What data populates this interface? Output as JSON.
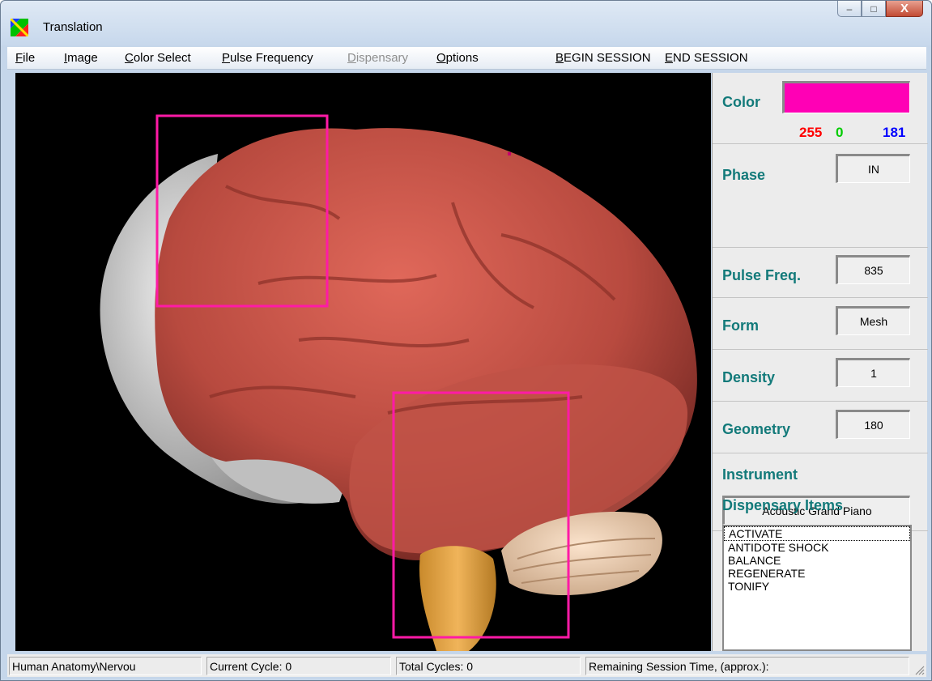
{
  "window": {
    "title": "Translation",
    "controls": {
      "minimize": "–",
      "maximize": "□",
      "close": "X"
    }
  },
  "menu": [
    {
      "pre": "",
      "ul": "F",
      "post": "ile"
    },
    {
      "pre": "",
      "ul": "I",
      "post": "mage"
    },
    {
      "pre": "",
      "ul": "C",
      "post": "olor Select"
    },
    {
      "pre": "",
      "ul": "P",
      "post": "ulse Frequency"
    },
    {
      "pre": "",
      "ul": "D",
      "post": "ispensary"
    },
    {
      "pre": "",
      "ul": "O",
      "post": "ptions"
    },
    {
      "pre": "",
      "ul": "B",
      "post": "EGIN SESSION"
    },
    {
      "pre": "",
      "ul": "E",
      "post": "ND SESSION"
    }
  ],
  "panel": {
    "color": {
      "label": "Color",
      "value_hex": "#ff00b5",
      "r": "255",
      "g": "0",
      "b": "181",
      "r_color": "#ff0000",
      "g_color": "#00cc00",
      "b_color": "#0000ff"
    },
    "phase": {
      "label": "Phase",
      "value": "IN"
    },
    "pulse_freq": {
      "label": "Pulse Freq.",
      "value": "835"
    },
    "form": {
      "label": "Form",
      "value": "Mesh"
    },
    "density": {
      "label": "Density",
      "value": "1"
    },
    "geometry": {
      "label": "Geometry",
      "value": "180"
    },
    "instrument": {
      "label": "Instrument",
      "value": "Acoustic Grand Piano"
    },
    "dispensary": {
      "label": "Dispensary Items",
      "items": [
        "ACTIVATE",
        "ANTIDOTE SHOCK",
        "BALANCE",
        "REGENERATE",
        "TONIFY"
      ]
    },
    "accent_color": "#137a7a"
  },
  "status": {
    "path": "Human Anatomy\\Nervou",
    "current_cycle": "Current Cycle:  0",
    "total_cycles": "Total Cycles:  0",
    "remaining": "Remaining Session Time, (approx.):"
  },
  "viewport": {
    "subject": "brain-3d-model",
    "highlight_color": "#ff1aa6",
    "brain_color": "#b84a3f"
  }
}
